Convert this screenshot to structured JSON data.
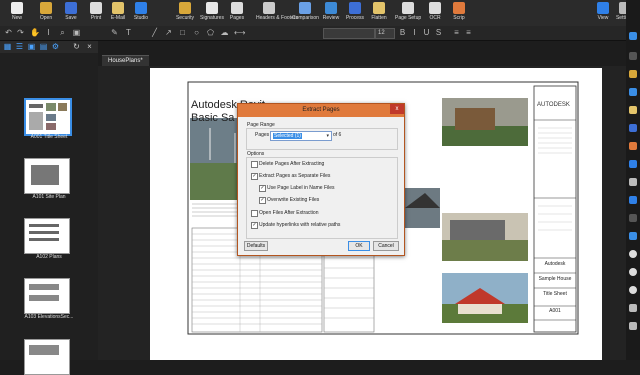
{
  "ribbon": {
    "buttons": [
      "New",
      "Open",
      "Save",
      "Print",
      "E-Mail",
      "Studio",
      "Security",
      "Signatures",
      "Pages",
      "Headers & Footers",
      "Comparison",
      "Review",
      "Process",
      "Flatten",
      "Page Setup",
      "OCR",
      "Scrip"
    ],
    "right": [
      "View",
      "Settings"
    ]
  },
  "toolbar": {
    "font_size": "12"
  },
  "thumbnails": [
    {
      "label": "A001 Title Sheet"
    },
    {
      "label": "A101 Site Plan"
    },
    {
      "label": "A102 Plans"
    },
    {
      "label": "A103 ElevationsSec..."
    },
    {
      "label": ""
    }
  ],
  "tab": {
    "name": "HousePlans*"
  },
  "drawing": {
    "title1": "Autodesk Revit",
    "title2": "Basic Sa",
    "brand": "AUTODESK",
    "company": "Autodesk",
    "project": "Sample House",
    "sheet": "Title Sheet",
    "sheetno": "A001"
  },
  "dialog": {
    "title": "Extract Pages",
    "page_range": "Page Range",
    "pages_label": "Pages",
    "pages_value": "Selected (1)",
    "of_label": "of 6",
    "options": "Options",
    "opt_delete": "Delete Pages After Extracting",
    "opt_separate": "Extract Pages as Separate Files",
    "opt_label": "Use Page Label in Name Files",
    "opt_overwrite": "Overwrite Existing Files",
    "opt_open": "Open Files After Extraction",
    "opt_update": "Update hyperlinks with relative paths",
    "defaults": "Defaults",
    "ok": "OK",
    "cancel": "Cancel",
    "close": "x"
  },
  "colors": {
    "accent": "#e07a3c",
    "selection": "#3a8ee6"
  }
}
